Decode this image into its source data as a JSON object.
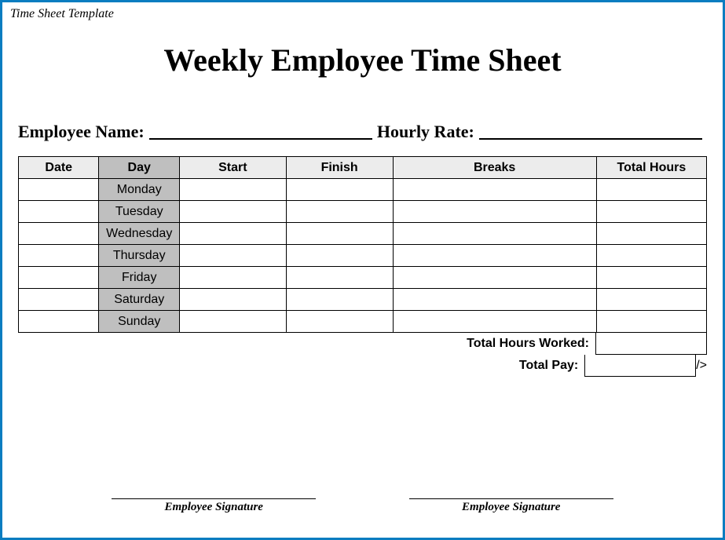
{
  "header_label": "Time Sheet Template",
  "title": "Weekly Employee Time Sheet",
  "meta": {
    "employee_name_label": "Employee Name:",
    "hourly_rate_label": "Hourly Rate:"
  },
  "columns": {
    "date": "Date",
    "day": "Day",
    "start": "Start",
    "finish": "Finish",
    "breaks": "Breaks",
    "total_hours": "Total Hours"
  },
  "days": [
    "Monday",
    "Tuesday",
    "Wednesday",
    "Thursday",
    "Friday",
    "Saturday",
    "Sunday"
  ],
  "totals": {
    "hours_worked_label": "Total Hours Worked:",
    "total_pay_label": "Total Pay:"
  },
  "signature": {
    "left": "Employee Signature",
    "right": "Employee Signature"
  }
}
